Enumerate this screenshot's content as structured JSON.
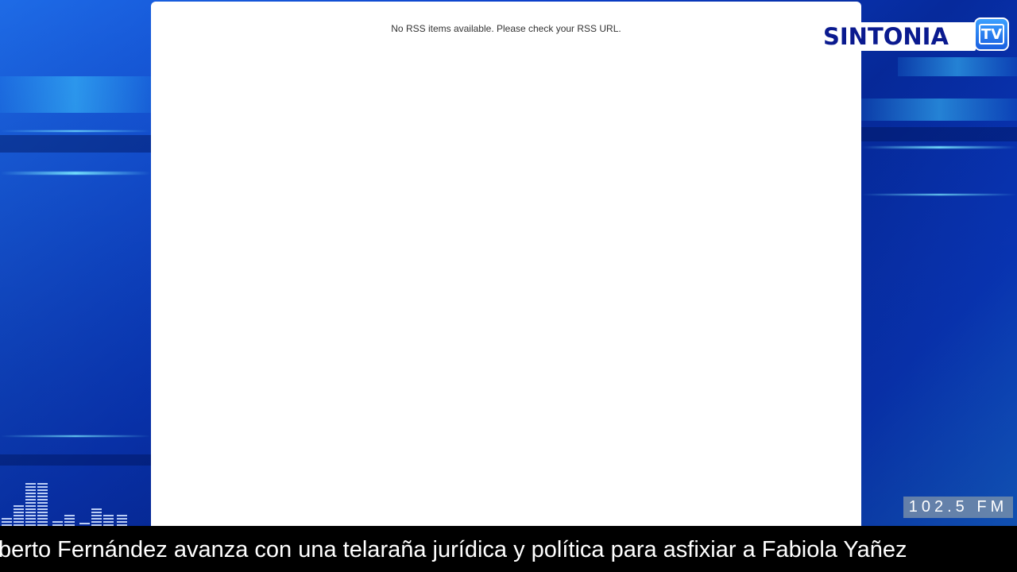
{
  "rss_panel": {
    "message": "No RSS items available. Please check your RSS URL."
  },
  "logo": {
    "text": "SINTONIA",
    "tv_label": "TV"
  },
  "fm_badge": {
    "label": "102.5 FM"
  },
  "ticker": {
    "text": "berto Fernández avanza con una telaraña jurídica y política para asfixiar a Fabiola Yañez"
  },
  "colors": {
    "background_blue": "#0b3ec9",
    "logo_navy": "#0a1a8f",
    "ticker_bg": "#000000",
    "panel_bg": "#ffffff"
  }
}
